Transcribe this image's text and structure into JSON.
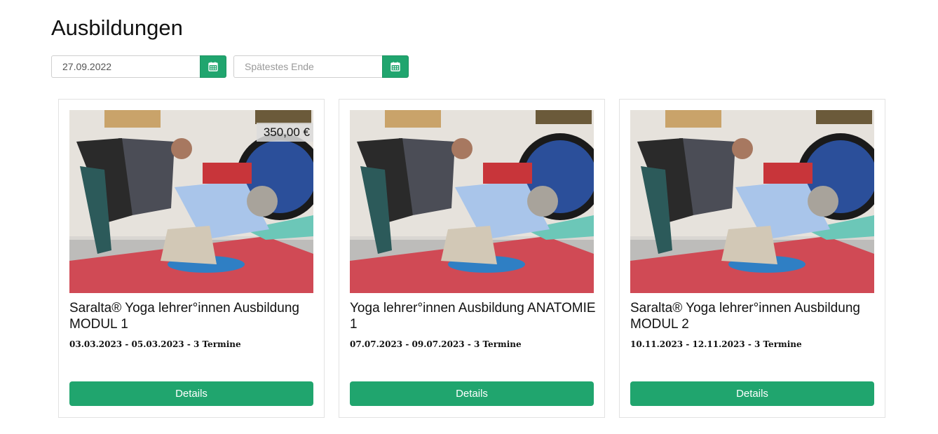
{
  "page": {
    "title": "Ausbildungen"
  },
  "filters": {
    "start": {
      "value": "27.09.2022",
      "placeholder": ""
    },
    "end": {
      "value": "",
      "placeholder": "Spätestes Ende"
    },
    "calendar_icon": "calendar-icon"
  },
  "colors": {
    "accent": "#20a56e"
  },
  "cards": [
    {
      "price": "350,00 €",
      "title": "Saralta® Yoga lehrer°innen Ausbildung MODUL 1",
      "dates": "03.03.2023 - 05.03.2023 - 3 Termine",
      "button": "Details"
    },
    {
      "price": "",
      "title": "Yoga lehrer°innen Ausbildung ANATOMIE 1",
      "dates": "07.07.2023 - 09.07.2023 - 3 Termine",
      "button": "Details"
    },
    {
      "price": "",
      "title": "Saralta® Yoga lehrer°innen Ausbildung MODUL 2",
      "dates": "10.11.2023 - 12.11.2023 - 3 Termine",
      "button": "Details"
    }
  ]
}
